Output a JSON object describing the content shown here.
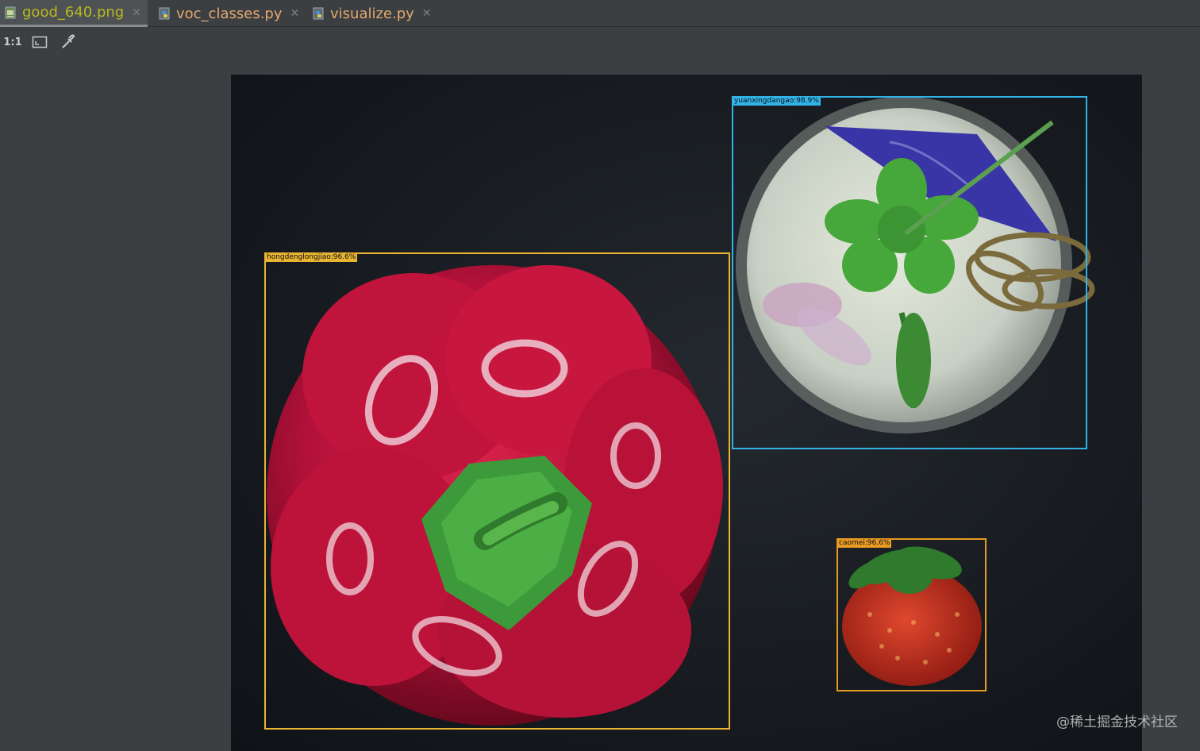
{
  "tabs": [
    {
      "label": "good_640.png",
      "icon": "image-file-icon",
      "active": true
    },
    {
      "label": "voc_classes.py",
      "icon": "python-file-icon",
      "active": false
    },
    {
      "label": "visualize.py",
      "icon": "python-file-icon",
      "active": false
    }
  ],
  "toolbar": {
    "actual_size_label": "1:1",
    "fit_icon": "fit-to-window-icon",
    "picker_icon": "color-picker-icon"
  },
  "detections": [
    {
      "label": "hongdenglongjiao:96.6%",
      "color": "#e8b432"
    },
    {
      "label": "yuanxingdangao:98.9%",
      "color": "#32b3e8"
    },
    {
      "label": "caomei:96.6%",
      "color": "#e89a22"
    }
  ],
  "watermark": "@稀土掘金技术社区",
  "colors": {
    "background": "#3c3f41",
    "tab_image_text": "#b8b81f",
    "tab_py_text": "#e3a86e"
  }
}
